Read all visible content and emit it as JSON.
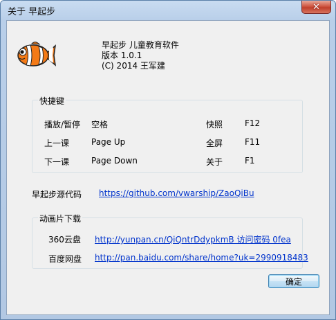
{
  "window": {
    "title": "关于 早起步",
    "close_glyph": "✕"
  },
  "app": {
    "name": "早起步 儿童教育软件",
    "version": "版本 1.0.1",
    "copyright": "(C) 2014 王军建"
  },
  "shortcuts": {
    "title": "快捷键",
    "rows": [
      {
        "action": "播放/暂停",
        "key": "空格",
        "action2": "快照",
        "key2": "F12"
      },
      {
        "action": "上一课",
        "key": "Page Up",
        "action2": "全屏",
        "key2": "F11"
      },
      {
        "action": "下一课",
        "key": "Page Down",
        "action2": "关于",
        "key2": "F1"
      }
    ]
  },
  "source": {
    "label": "早起步源代码",
    "url": "https://github.com/vwarship/ZaoQiBu"
  },
  "downloads": {
    "title": "动画片下载",
    "items": [
      {
        "label": "360云盘",
        "url": "http://yunpan.cn/QiQntrDdypkmB  访问密码 0fea"
      },
      {
        "label": "百度网盘",
        "url": "http://pan.baidu.com/share/home?uk=2990918483"
      }
    ]
  },
  "buttons": {
    "ok": "确定"
  }
}
